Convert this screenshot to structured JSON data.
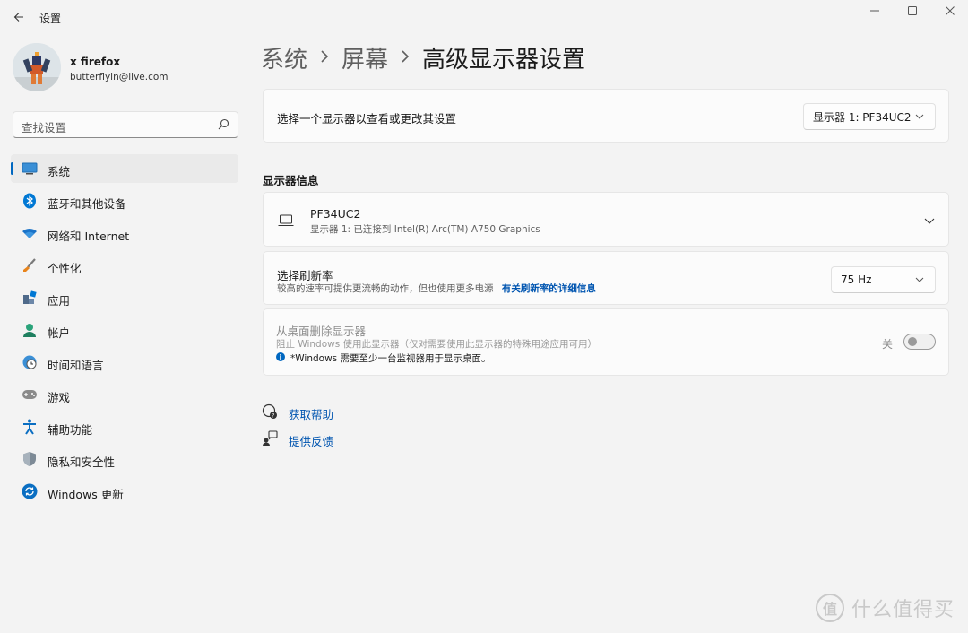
{
  "window": {
    "title": "设置",
    "back_icon": "arrow-left-icon",
    "controls": [
      "minimize-icon",
      "maximize-icon",
      "close-icon"
    ]
  },
  "profile": {
    "name": "x firefox",
    "email": "butterflyin@live.com"
  },
  "search": {
    "placeholder": "查找设置"
  },
  "nav": {
    "items": [
      {
        "label": "系统",
        "icon": "monitor-icon",
        "active": true
      },
      {
        "label": "蓝牙和其他设备",
        "icon": "bluetooth-icon"
      },
      {
        "label": "网络和 Internet",
        "icon": "wifi-icon"
      },
      {
        "label": "个性化",
        "icon": "brush-icon"
      },
      {
        "label": "应用",
        "icon": "apps-icon"
      },
      {
        "label": "帐户",
        "icon": "account-icon"
      },
      {
        "label": "时间和语言",
        "icon": "globe-clock-icon"
      },
      {
        "label": "游戏",
        "icon": "gamepad-icon"
      },
      {
        "label": "辅助功能",
        "icon": "accessibility-icon"
      },
      {
        "label": "隐私和安全性",
        "icon": "shield-icon"
      },
      {
        "label": "Windows 更新",
        "icon": "sync-icon"
      }
    ]
  },
  "breadcrumb": {
    "part1": "系统",
    "part2": "屏幕",
    "current": "高级显示器设置"
  },
  "select_display": {
    "label": "选择一个显示器以查看或更改其设置",
    "value": "显示器 1: PF34UC2"
  },
  "display_info": {
    "section_title": "显示器信息",
    "name": "PF34UC2",
    "detail": "显示器 1: 已连接到 Intel(R) Arc(TM) A750 Graphics"
  },
  "refresh_rate": {
    "title": "选择刷新率",
    "desc": "较高的速率可提供更流畅的动作，但也使用更多电源",
    "link": "有关刷新率的详细信息",
    "value": "75 Hz"
  },
  "remove_display": {
    "title": "从桌面删除显示器",
    "desc": "阻止 Windows 使用此显示器（仅对需要使用此显示器的特殊用途应用可用）",
    "note": "*Windows 需要至少一台监视器用于显示桌面。",
    "toggle_label": "关",
    "toggle_on": false
  },
  "help": {
    "get_help": "获取帮助",
    "feedback": "提供反馈"
  },
  "watermark": {
    "logo_char": "值",
    "text": "什么值得买"
  },
  "colors": {
    "accent": "#0067c0",
    "link": "#0055b0",
    "background": "#f3f3f3",
    "card": "#fbfbfb"
  }
}
